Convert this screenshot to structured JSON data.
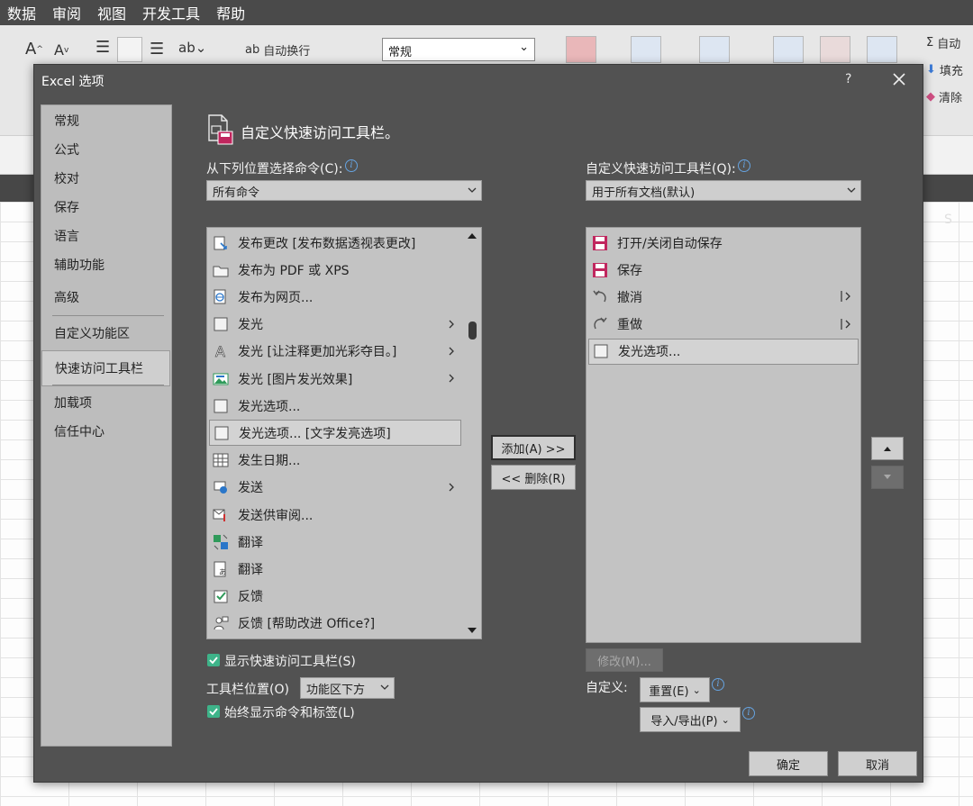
{
  "menu": [
    "数据",
    "审阅",
    "视图",
    "开发工具",
    "帮助"
  ],
  "ribbon": {
    "wrap_text": "自动换行",
    "number_format": "常规",
    "autosum": "自动",
    "fill": "填充",
    "clear": "清除"
  },
  "sheet": {
    "column_label": "S"
  },
  "dialog": {
    "title": "Excel 选项",
    "help": "?",
    "nav": [
      "常规",
      "公式",
      "校对",
      "保存",
      "语言",
      "辅助功能",
      "高级",
      "自定义功能区",
      "快速访问工具栏",
      "加载项",
      "信任中心"
    ],
    "selected_nav": "快速访问工具栏",
    "header_title": "自定义快速访问工具栏。",
    "left_label": "从下列位置选择命令(C):",
    "left_combo": "所有命令",
    "right_label": "自定义快速访问工具栏(Q):",
    "right_combo": "用于所有文档(默认)",
    "commands": [
      {
        "label": "发布更改 [发布数据透视表更改]",
        "icon": "publish-changes-icon"
      },
      {
        "label": "发布为 PDF 或 XPS",
        "icon": "folder-icon"
      },
      {
        "label": "发布为网页...",
        "icon": "globe-page-icon"
      },
      {
        "label": "发光",
        "icon": "square-icon",
        "submenu": true
      },
      {
        "label": "发光 [让注释更加光彩夺目。]",
        "icon": "letter-a-icon",
        "submenu": true
      },
      {
        "label": "发光 [图片发光效果]",
        "icon": "picture-icon",
        "submenu": true
      },
      {
        "label": "发光选项...",
        "icon": "square-icon"
      },
      {
        "label": "发光选项... [文字发亮选项]",
        "icon": "square-icon",
        "selected": true
      },
      {
        "label": "发生日期...",
        "icon": "calendar-grid-icon"
      },
      {
        "label": "发送",
        "icon": "send-icon",
        "submenu": true
      },
      {
        "label": "发送供审阅...",
        "icon": "send-review-icon"
      },
      {
        "label": "翻译",
        "icon": "translate-icon"
      },
      {
        "label": "翻译",
        "icon": "translate-doc-icon"
      },
      {
        "label": "反馈",
        "icon": "feedback-check-icon"
      },
      {
        "label": "反馈 [帮助改进 Office?]",
        "icon": "feedback-person-icon"
      }
    ],
    "qat": [
      {
        "label": "打开/关闭自动保存",
        "icon": "autosave-icon"
      },
      {
        "label": "保存",
        "icon": "save-icon"
      },
      {
        "label": "撤消",
        "icon": "undo-icon",
        "separator_arrow": true
      },
      {
        "label": "重做",
        "icon": "redo-icon",
        "separator_arrow": true
      },
      {
        "label": "发光选项...",
        "icon": "square-icon",
        "selected": true
      }
    ],
    "add_button": "添加(A) >>",
    "remove_button": "<< 删除(R)",
    "modify_button": "修改(M)...",
    "show_qat": "显示快速访问工具栏(S)",
    "toolbar_position_label": "工具栏位置(O)",
    "toolbar_position_value": "功能区下方",
    "always_show_labels": "始终显示命令和标签(L)",
    "customize_label": "自定义:",
    "reset_button": "重置(E)",
    "import_export_button": "导入/导出(P)",
    "ok_button": "确定",
    "cancel_button": "取消",
    "colors": {
      "dialog_bg": "#525252",
      "checkbox": "#3eb389",
      "save_icon": "#c0265e",
      "info": "#66a3e0"
    }
  }
}
